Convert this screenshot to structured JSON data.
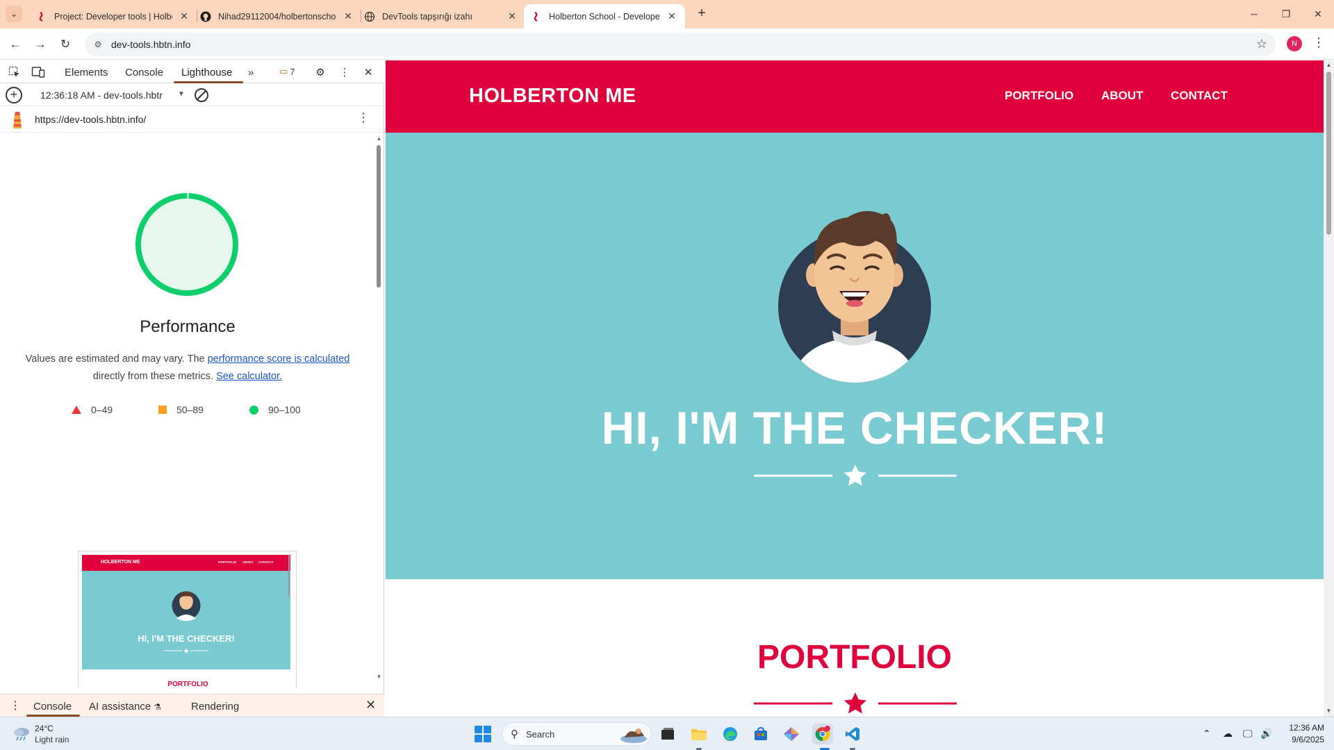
{
  "browser": {
    "tabs": [
      {
        "title": "Project: Developer tools | Holbe",
        "icon": "holberton-icon",
        "active": false
      },
      {
        "title": "Nihad29112004/holbertonscho",
        "icon": "github-icon",
        "active": false
      },
      {
        "title": "DevTools tapşırığı izahı",
        "icon": "globe-icon",
        "active": false
      },
      {
        "title": "Holberton School - Developer t",
        "icon": "holberton-icon",
        "active": true
      }
    ],
    "url": "dev-tools.hbtn.info",
    "profile_initial": "N"
  },
  "devtools": {
    "tabs": [
      "Elements",
      "Console",
      "Lighthouse"
    ],
    "active_tab": "Lighthouse",
    "issues_count": "7",
    "report_select": "12:36:18 AM - dev-tools.hbtr",
    "report_url": "https://dev-tools.hbtn.info/",
    "category": "Performance",
    "score_fraction": 1.0,
    "desc_prefix": "Values are estimated and may vary. The ",
    "desc_link1": "performance score is calculated",
    "desc_middle": "directly from these metrics. ",
    "desc_link2": "See calculator.",
    "legend": [
      {
        "shape": "triangle",
        "range": "0–49",
        "color": "#e53935"
      },
      {
        "shape": "square",
        "range": "50–89",
        "color": "#fa9e1b"
      },
      {
        "shape": "circle",
        "range": "90–100",
        "color": "#0cce6b"
      }
    ],
    "thumbnail": {
      "brand": "HOLBERTON ME",
      "nav": [
        "PORTFOLIO",
        "ABOUT",
        "CONTACT"
      ],
      "title": "HI, I'M THE CHECKER!",
      "section": "PORTFOLIO"
    },
    "drawer_tabs": [
      "Console",
      "AI assistance",
      "Rendering"
    ],
    "active_drawer_tab": "Console"
  },
  "site": {
    "brand": "HOLBERTON ME",
    "nav": [
      "PORTFOLIO",
      "ABOUT",
      "CONTACT"
    ],
    "hero_title": "HI, I'M THE CHECKER!",
    "section_title": "PORTFOLIO",
    "colors": {
      "primary": "#e0003c",
      "hero_bg": "#79cbd1"
    }
  },
  "taskbar": {
    "weather_temp": "24°C",
    "weather_desc": "Light rain",
    "search_label": "Search",
    "time": "12:36 AM",
    "date": "9/6/2025"
  }
}
